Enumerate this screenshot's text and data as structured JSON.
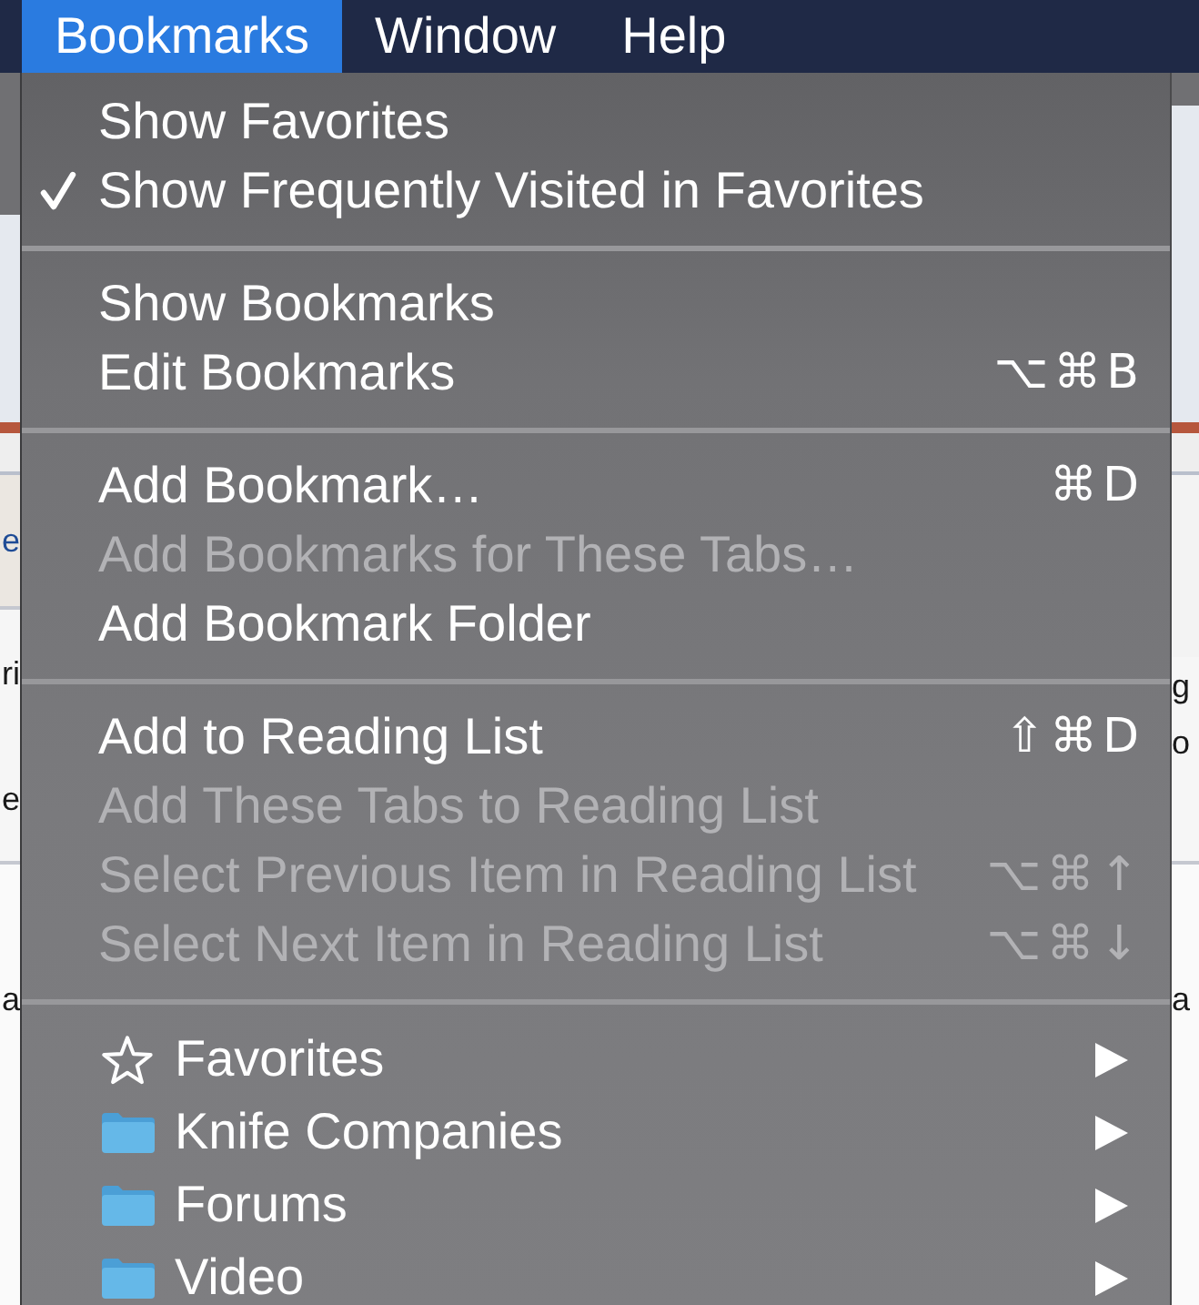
{
  "menu_bar": {
    "items": [
      {
        "label": "Bookmarks",
        "selected": true
      },
      {
        "label": "Window",
        "selected": false
      },
      {
        "label": "Help",
        "selected": false
      }
    ]
  },
  "menu": {
    "sections": [
      {
        "items": [
          {
            "kind": "command",
            "label": "Show Favorites",
            "checked": false,
            "disabled": false
          },
          {
            "kind": "command",
            "label": "Show Frequently Visited in Favorites",
            "checked": true,
            "disabled": false
          }
        ]
      },
      {
        "items": [
          {
            "kind": "command",
            "label": "Show Bookmarks",
            "checked": false,
            "disabled": false
          },
          {
            "kind": "command",
            "label": "Edit Bookmarks",
            "shortcut": "⌥⌘B",
            "checked": false,
            "disabled": false
          }
        ]
      },
      {
        "items": [
          {
            "kind": "command",
            "label": "Add Bookmark…",
            "shortcut": "⌘D",
            "checked": false,
            "disabled": false
          },
          {
            "kind": "command",
            "label": "Add Bookmarks for These Tabs…",
            "checked": false,
            "disabled": true
          },
          {
            "kind": "command",
            "label": "Add Bookmark Folder",
            "checked": false,
            "disabled": false
          }
        ]
      },
      {
        "items": [
          {
            "kind": "command",
            "label": "Add to Reading List",
            "shortcut": "⇧⌘D",
            "checked": false,
            "disabled": false
          },
          {
            "kind": "command",
            "label": "Add These Tabs to Reading List",
            "checked": false,
            "disabled": true
          },
          {
            "kind": "command",
            "label": "Select Previous Item in Reading List",
            "shortcut": "⌥⌘↑",
            "checked": false,
            "disabled": true
          },
          {
            "kind": "command",
            "label": "Select Next Item in Reading List",
            "shortcut": "⌥⌘↓",
            "checked": false,
            "disabled": true
          }
        ]
      },
      {
        "items": [
          {
            "kind": "favorites",
            "label": "Favorites",
            "submenu": true
          },
          {
            "kind": "folder",
            "label": "Knife Companies",
            "submenu": true
          },
          {
            "kind": "folder",
            "label": "Forums",
            "submenu": true
          },
          {
            "kind": "folder",
            "label": "Video",
            "submenu": true
          }
        ]
      }
    ]
  },
  "page_behind": {
    "left_edge": [
      {
        "kind": "link",
        "text": "e"
      },
      {
        "kind": "text",
        "text": "ri"
      },
      {
        "kind": "text",
        "text": "e"
      },
      {
        "kind": "text",
        "text": "a"
      }
    ],
    "right_edge": [
      {
        "kind": "text",
        "text": "g"
      },
      {
        "kind": "text",
        "text": "o"
      },
      {
        "kind": "text",
        "text": "a"
      }
    ]
  }
}
